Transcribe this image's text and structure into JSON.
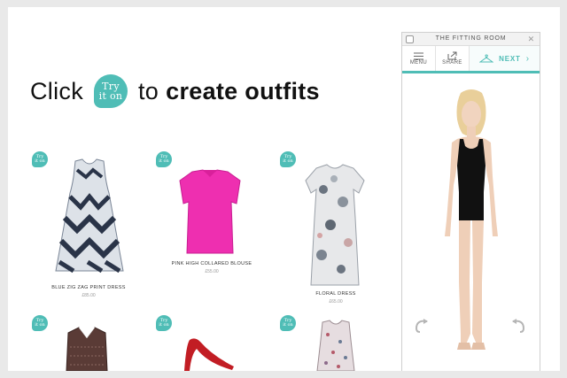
{
  "headline": {
    "word1": "Click",
    "word2": "to",
    "word3": "create outfits",
    "badge_line1": "Try",
    "badge_line2": "it on"
  },
  "badge": {
    "line1": "Try",
    "line2": "it on"
  },
  "products": [
    {
      "name": "BLUE ZIG ZAG PRINT DRESS",
      "price": "£85.00"
    },
    {
      "name": "PINK HIGH COLLARED BLOUSE",
      "price": "£55.00"
    },
    {
      "name": "FLORAL DRESS",
      "price": "£65.00"
    }
  ],
  "panel": {
    "title": "THE FITTING ROOM",
    "menu_label": "MENU",
    "share_label": "SHARE",
    "next_label": "NEXT"
  },
  "colors": {
    "accent": "#4fbdb6",
    "pink": "#ee2fb0"
  },
  "icons": [
    "menu-icon",
    "share-icon",
    "hanger-icon",
    "chevron-right-icon",
    "rotate-left-icon",
    "rotate-right-icon",
    "close-icon"
  ]
}
